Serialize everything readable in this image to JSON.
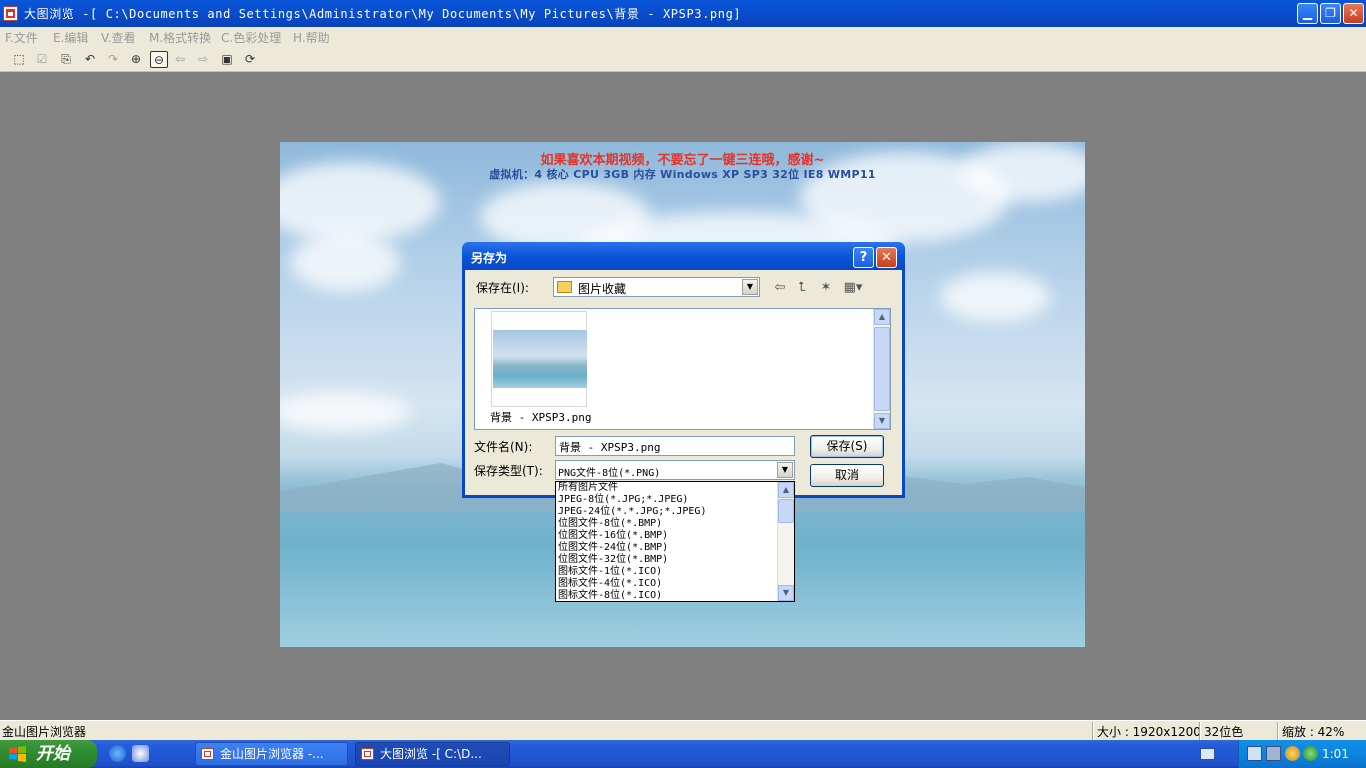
{
  "window": {
    "title": "大图浏览 -[ C:\\Documents and Settings\\Administrator\\My Documents\\My Pictures\\背景 - XPSP3.png]",
    "min_label": "▁",
    "max_label": "❐",
    "close_label": "✕"
  },
  "menu": [
    "F.文件",
    "E.编辑",
    "V.查看",
    "M.格式转换",
    "C.色彩处理",
    "H.帮助"
  ],
  "toolbar_icons": [
    "select-rect",
    "check",
    "copy",
    "undo",
    "redo",
    "zoom-in",
    "zoom-out",
    "prev",
    "next",
    "fit",
    "rotate"
  ],
  "image": {
    "banner_line1": "如果喜欢本期视频，不要忘了一键三连哦，感谢~",
    "banner_line2": "虚拟机：4 核心 CPU   3GB 内存   Windows XP SP3 32位   IE8   WMP11"
  },
  "dialog": {
    "title": "另存为",
    "help_label": "?",
    "close_label": "✕",
    "save_in_label": "保存在(I):",
    "save_in_value": "图片收藏",
    "file_caption": "背景 - XPSP3.png",
    "filename_label": "文件名(N):",
    "filename_value": "背景 - XPSP3.png",
    "filetype_label": "保存类型(T):",
    "filetype_value": "PNG文件-8位(*.PNG)",
    "save_button": "保存(S)",
    "cancel_button": "取消",
    "type_options": [
      "所有图片文件",
      "JPEG-8位(*.JPG;*.JPEG)",
      "JPEG-24位(*.*.JPG;*.JPEG)",
      "位图文件-8位(*.BMP)",
      "位图文件-16位(*.BMP)",
      "位图文件-24位(*.BMP)",
      "位图文件-32位(*.BMP)",
      "图标文件-1位(*.ICO)",
      "图标文件-4位(*.ICO)",
      "图标文件-8位(*.ICO)"
    ]
  },
  "status": {
    "app_name": "金山图片浏览器",
    "size": "大小 : 1920x1200",
    "depth": "32位色",
    "zoom": "缩放 : 42%"
  },
  "taskbar": {
    "start": "开始",
    "tasks": [
      "金山图片浏览器 -...",
      "大图浏览 -[ C:\\D..."
    ],
    "clock": "1:01"
  }
}
